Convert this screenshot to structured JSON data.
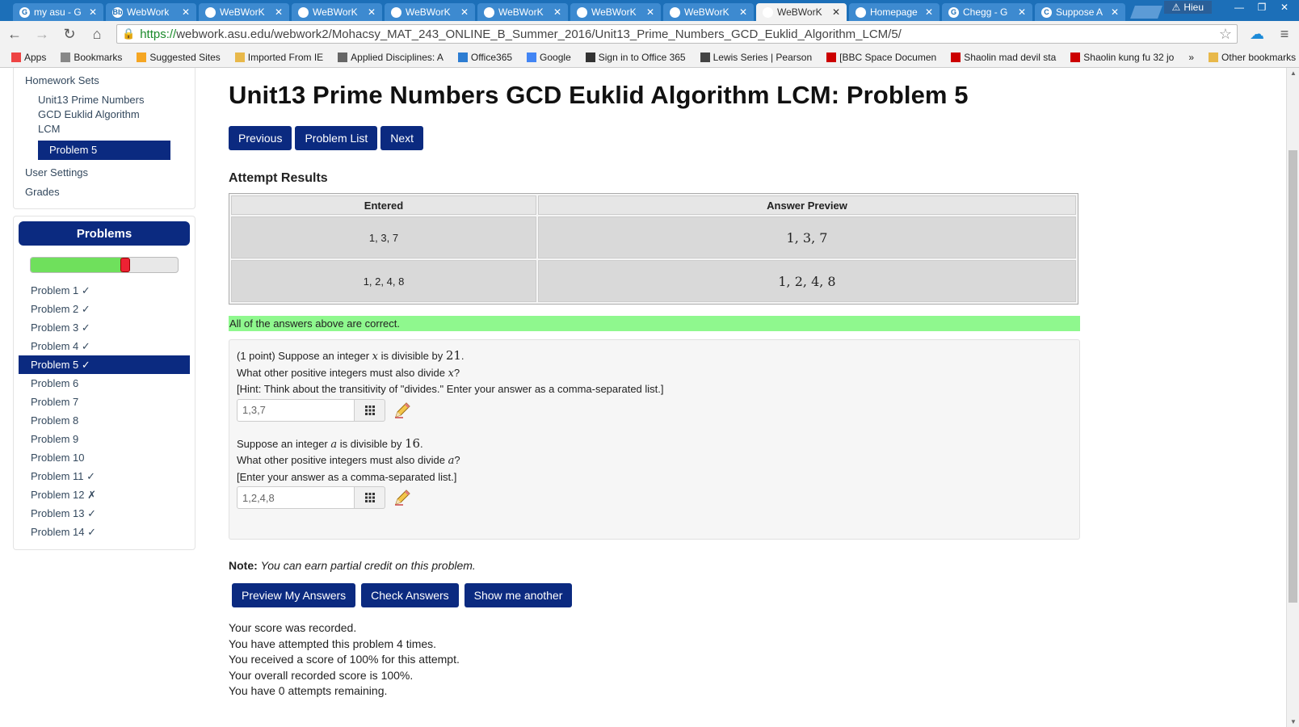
{
  "browser": {
    "tabs": [
      {
        "label": "my asu - G",
        "fav": "G",
        "active": false
      },
      {
        "label": "WebWork",
        "fav": "Bb",
        "active": false
      },
      {
        "label": "WeBWorK",
        "fav": "",
        "active": false
      },
      {
        "label": "WeBWorK",
        "fav": "",
        "active": false
      },
      {
        "label": "WeBWorK",
        "fav": "",
        "active": false
      },
      {
        "label": "WeBWorK",
        "fav": "",
        "active": false
      },
      {
        "label": "WeBWorK",
        "fav": "",
        "active": false
      },
      {
        "label": "WeBWorK",
        "fav": "",
        "active": false
      },
      {
        "label": "WeBWorK",
        "fav": "",
        "active": true
      },
      {
        "label": "Homepage",
        "fav": "",
        "active": false
      },
      {
        "label": "Chegg - G",
        "fav": "G",
        "active": false
      },
      {
        "label": "Suppose A",
        "fav": "C",
        "active": false
      }
    ],
    "user": "Hieu",
    "url_scheme": "https://",
    "url_rest": "webwork.asu.edu/webwork2/Mohacsy_MAT_243_ONLINE_B_Summer_2016/Unit13_Prime_Numbers_GCD_Euklid_Algorithm_LCM/5/",
    "bookmarks": [
      "Apps",
      "Bookmarks",
      "Suggested Sites",
      "Imported From IE",
      "Applied Disciplines: A",
      "Office365",
      "Google",
      "Sign in to Office 365",
      "Lewis Series | Pearson",
      "[BBC Space Documen",
      "Shaolin mad devil sta",
      "Shaolin kung fu 32 jo"
    ],
    "more_bookmarks": "»",
    "other_bookmarks": "Other bookmarks"
  },
  "sidebar": {
    "homework_sets": "Homework Sets",
    "set_name": "Unit13 Prime Numbers GCD Euklid Algorithm LCM",
    "current_problem": "Problem 5",
    "user_settings": "User Settings",
    "grades": "Grades",
    "problems_header": "Problems",
    "progress_fraction": 0.62,
    "problems": [
      {
        "label": "Problem 1 ✓",
        "active": false
      },
      {
        "label": "Problem 2 ✓",
        "active": false
      },
      {
        "label": "Problem 3 ✓",
        "active": false
      },
      {
        "label": "Problem 4 ✓",
        "active": false
      },
      {
        "label": "Problem 5 ✓",
        "active": true
      },
      {
        "label": "Problem 6",
        "active": false
      },
      {
        "label": "Problem 7",
        "active": false
      },
      {
        "label": "Problem 8",
        "active": false
      },
      {
        "label": "Problem 9",
        "active": false
      },
      {
        "label": "Problem 10",
        "active": false
      },
      {
        "label": "Problem 11 ✓",
        "active": false
      },
      {
        "label": "Problem 12 ✗",
        "active": false
      },
      {
        "label": "Problem 13 ✓",
        "active": false
      },
      {
        "label": "Problem 14 ✓",
        "active": false
      }
    ]
  },
  "main": {
    "title": "Unit13 Prime Numbers GCD Euklid Algorithm LCM: Problem 5",
    "nav": {
      "previous": "Previous",
      "problem_list": "Problem List",
      "next": "Next"
    },
    "attempt_results": "Attempt Results",
    "table": {
      "headers": [
        "Entered",
        "Answer Preview"
      ],
      "rows": [
        {
          "entered": "1, 3, 7",
          "preview": "1, 3, 7"
        },
        {
          "entered": "1, 2, 4, 8",
          "preview": "1, 2, 4, 8"
        }
      ]
    },
    "correct_msg": "All of the answers above are correct.",
    "problem": {
      "p1_line1_a": "(1 point) Suppose an integer ",
      "p1_var": "x",
      "p1_line1_b": " is divisible by ",
      "p1_num": "21",
      "p1_line1_c": ".",
      "p1_line2_a": "What other positive integers must also divide ",
      "p1_line2_b": "?",
      "p1_hint": "[Hint: Think about the transitivity of \"divides.\" Enter your answer as a comma-separated list.]",
      "ans1": "1,3,7",
      "p2_line1_a": "Suppose an integer ",
      "p2_var": "a",
      "p2_line1_b": " is divisible by ",
      "p2_num": "16",
      "p2_line1_c": ".",
      "p2_line2_a": "What other positive integers must also divide ",
      "p2_line2_b": "?",
      "p2_hint": "[Enter your answer as a comma-separated list.]",
      "ans2": "1,2,4,8"
    },
    "note_label": "Note:",
    "note_text": "You can earn partial credit on this problem.",
    "actions": {
      "preview": "Preview My Answers",
      "check": "Check Answers",
      "another": "Show me another"
    },
    "score_lines": [
      "Your score was recorded.",
      "You have attempted this problem 4 times.",
      "You received a score of 100% for this attempt.",
      "Your overall recorded score is 100%.",
      "You have 0 attempts remaining."
    ]
  },
  "colors": {
    "accent": "#0b2a80",
    "correct": "#8ff88e",
    "chrome": "#1c6fb8"
  }
}
